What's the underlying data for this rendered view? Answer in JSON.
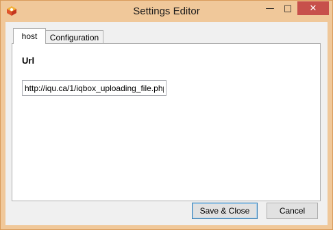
{
  "window": {
    "title": "Settings Editor",
    "min_glyph": "—",
    "max_glyph": "□",
    "close_glyph": "✕"
  },
  "tabs": [
    {
      "label": "host",
      "selected": true
    },
    {
      "label": "Configuration",
      "selected": false
    }
  ],
  "host": {
    "url_label": "Url",
    "url_value": "http://iqu.ca/1/iqbox_uploading_file.php"
  },
  "buttons": {
    "save_close": "Save & Close",
    "cancel": "Cancel"
  },
  "colors": {
    "titlebar": "#f0c89a",
    "close_button": "#c7504b"
  }
}
